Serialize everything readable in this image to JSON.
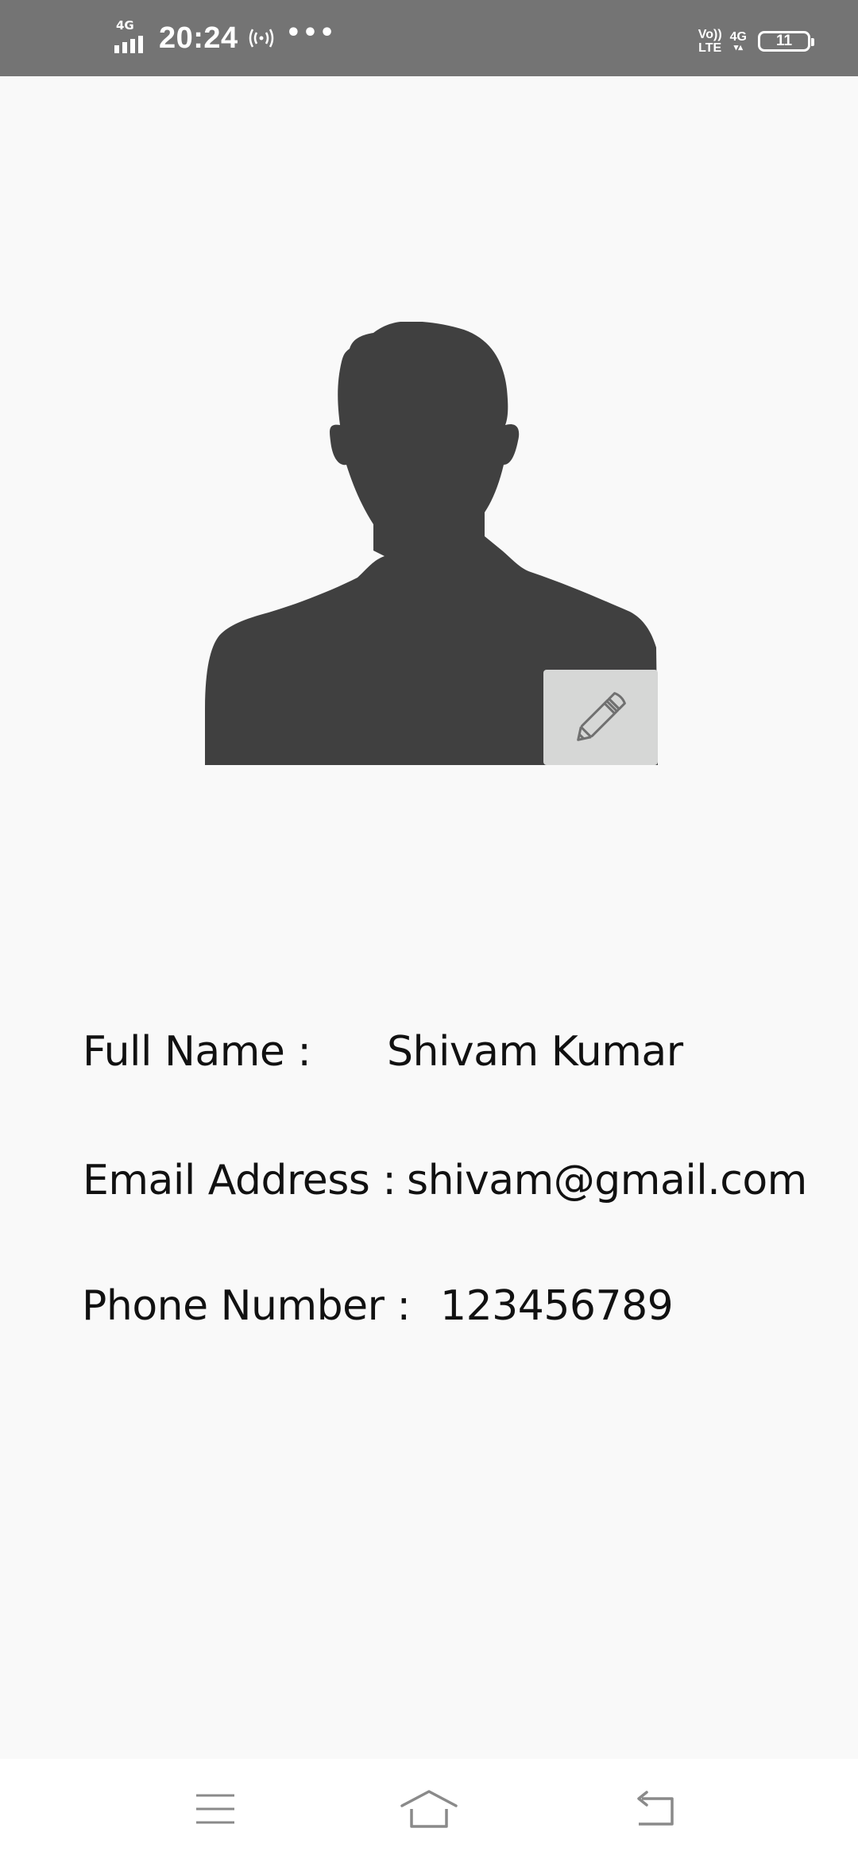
{
  "status_bar": {
    "network_left": "4G",
    "time": "20:24",
    "volte_top": "Vo))",
    "volte_bottom": "LTE",
    "network_right": "4G",
    "battery_level": "11"
  },
  "profile": {
    "full_name_label": "Full Name :",
    "full_name_value": "Shivam Kumar",
    "email_label": "Email Address :",
    "email_value": "shivam@gmail.com",
    "phone_label": "Phone Number :",
    "phone_value": "123456789"
  },
  "icons": {
    "avatar": "person-silhouette-icon",
    "edit": "pencil-icon",
    "nav_menu": "menu-icon",
    "nav_home": "home-icon",
    "nav_back": "back-icon"
  },
  "colors": {
    "status_bar": "#747474",
    "background": "#f9f9f9",
    "avatar": "#404040",
    "edit_button": "#d6d7d6",
    "nav_icons": "#8a8a8a"
  }
}
